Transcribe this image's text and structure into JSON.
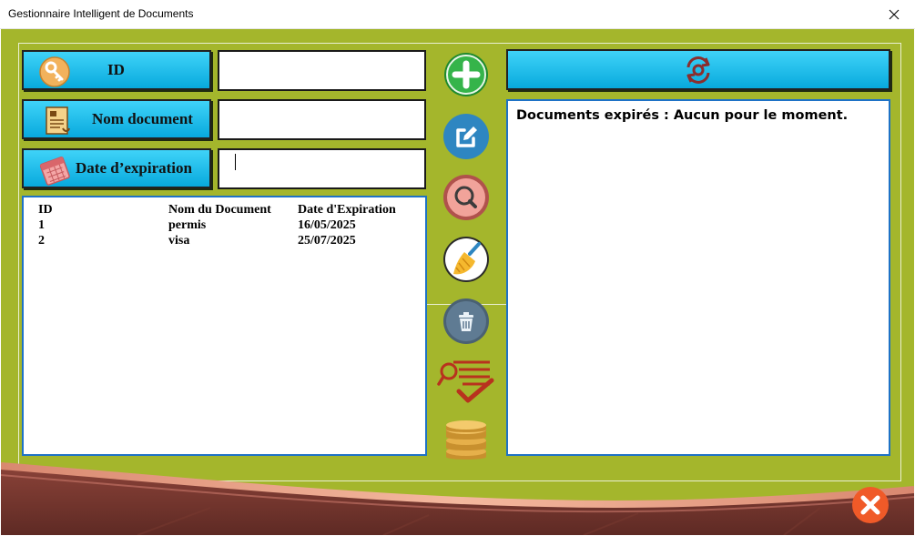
{
  "window": {
    "title": "Gestionnaire Intelligent de Documents"
  },
  "form": {
    "id_label": "ID",
    "name_label": "Nom document",
    "expiry_label": "Date d’expiration",
    "id_value": "",
    "name_value": "",
    "expiry_value": ""
  },
  "table": {
    "headers": [
      "ID",
      "Nom du Document",
      "Date d'Expiration"
    ],
    "rows": [
      [
        "1",
        "permis",
        "16/05/2025"
      ],
      [
        "2",
        "visa",
        "25/07/2025"
      ]
    ]
  },
  "expired": {
    "message": "Documents expirés : Aucun pour le moment."
  },
  "icons": {
    "id_button": "key-icon",
    "name_button": "document-icon",
    "expiry_button": "calendar-icon",
    "add": "add-icon",
    "edit": "edit-icon",
    "search": "search-icon",
    "clear": "broom-icon",
    "delete": "trash-icon",
    "check": "check-list-icon",
    "database": "database-icon",
    "refresh": "refresh-gear-icon",
    "exit": "close-icon"
  },
  "colors": {
    "background": "#a4b62c",
    "button": "#19bde9",
    "list_border": "#1e72c6",
    "exit": "#f05a28"
  }
}
